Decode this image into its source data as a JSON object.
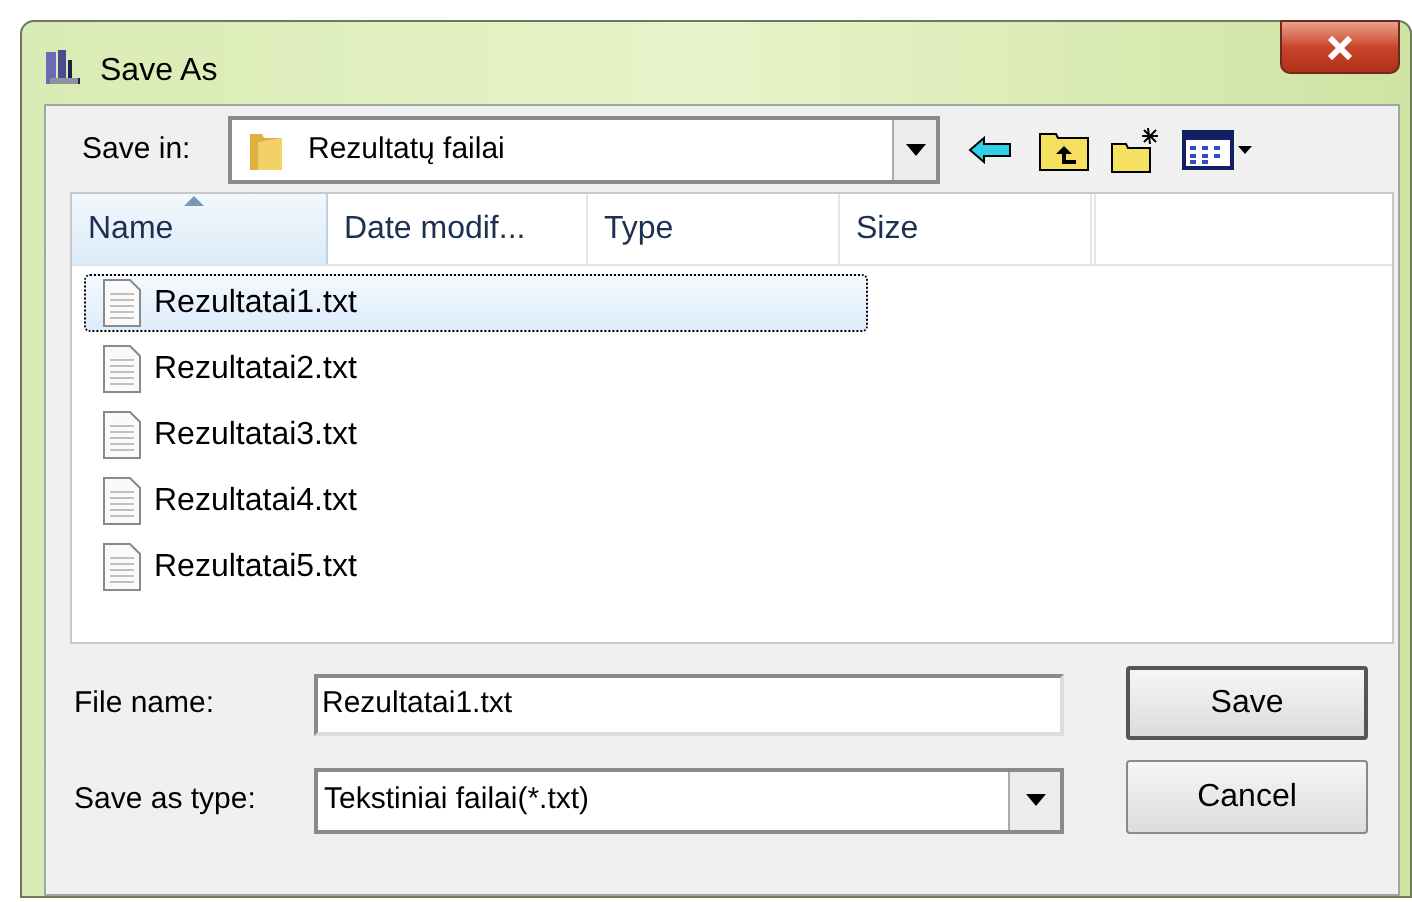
{
  "window": {
    "title": "Save As"
  },
  "save_in": {
    "label": "Save in:",
    "value": "Rezultatų failai"
  },
  "columns": [
    {
      "label": "Name",
      "sorted": true
    },
    {
      "label": "Date modif...",
      "sorted": false
    },
    {
      "label": "Type",
      "sorted": false
    },
    {
      "label": "Size",
      "sorted": false
    }
  ],
  "files": [
    {
      "name": "Rezultatai1.txt",
      "selected": true
    },
    {
      "name": "Rezultatai2.txt",
      "selected": false
    },
    {
      "name": "Rezultatai3.txt",
      "selected": false
    },
    {
      "name": "Rezultatai4.txt",
      "selected": false
    },
    {
      "name": "Rezultatai5.txt",
      "selected": false
    }
  ],
  "file_name": {
    "label": "File name:",
    "value": "Rezultatai1.txt"
  },
  "save_as_type": {
    "label": "Save as type:",
    "value": "Tekstiniai failai(*.txt)"
  },
  "buttons": [
    "Save",
    "Cancel"
  ]
}
